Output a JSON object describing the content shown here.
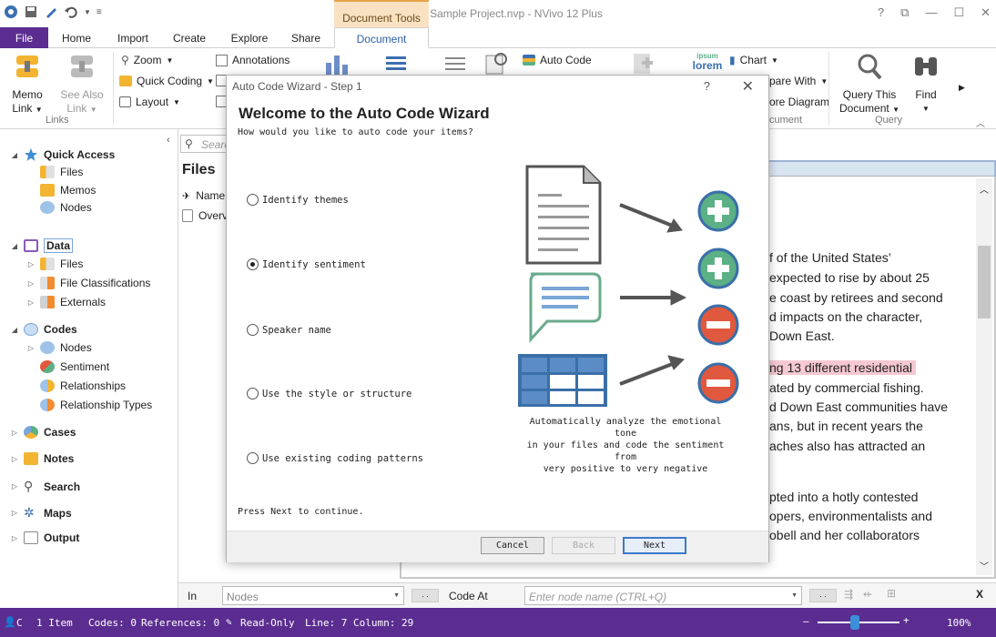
{
  "window": {
    "title": "Sample Project.nvp - NVivo 12 Plus",
    "context_tab_group": "Document Tools",
    "controls": [
      "?",
      "⧉",
      "—",
      "☐",
      "✕"
    ]
  },
  "tabs": [
    "File",
    "Home",
    "Import",
    "Create",
    "Explore",
    "Share",
    "Document"
  ],
  "ribbon": {
    "memo_link": "Memo\nLink",
    "memo_link_l1": "Memo",
    "memo_link_l2": "Link",
    "see_also_l1": "See Also",
    "see_also_l2": "Link",
    "links_group": "Links",
    "zoom": "Zoom",
    "quick_coding": "Quick Coding",
    "layout": "Layout",
    "annotations": "Annotations",
    "auto_code": "Auto Code",
    "chart": "Chart",
    "compare_with": "pare With",
    "explore_diagram": "ore Diagram",
    "document_group": "cument",
    "query_this_l1": "Query This",
    "query_this_l2": "Document",
    "find": "Find",
    "query_group": "Query",
    "lorem_label": "lorem",
    "ipsum_label": "ipsum"
  },
  "nav": {
    "quick_access": "Quick Access",
    "qa_files": "Files",
    "qa_memos": "Memos",
    "qa_nodes": "Nodes",
    "data": "Data",
    "data_files": "Files",
    "file_classifications": "File Classifications",
    "externals": "Externals",
    "codes": "Codes",
    "codes_nodes": "Nodes",
    "sentiment": "Sentiment",
    "relationships": "Relationships",
    "relationship_types": "Relationship Types",
    "cases": "Cases",
    "notes": "Notes",
    "search": "Search",
    "maps": "Maps",
    "output": "Output"
  },
  "files_panel": {
    "search_placeholder": "Search",
    "title": "Files",
    "col_name": "Name",
    "row1": "Overv"
  },
  "document_lines": [
    "f of the United States’",
    "expected to rise by about 25",
    "e coast by retirees and second",
    "d impacts on the character,",
    "Down East.",
    "ng 13 different residential",
    "ated by commercial fishing.",
    "d Down East communities have",
    "ans, but in recent years the",
    "aches also has attracted an",
    "pted into a hotly contested",
    "opers, environmentalists and",
    "obell and her collaborators"
  ],
  "highlight_color": "#f6c9d2",
  "code_bar": {
    "in_label": "In",
    "in_value": "Nodes",
    "code_at_label": "Code At",
    "node_placeholder": "Enter node name (CTRL+Q)",
    "close": "X"
  },
  "status": {
    "user": "C",
    "items": "1 Item",
    "codes": "Codes: 0",
    "references": "References: 0",
    "read_only": "Read-Only",
    "position": "Line: 7 Column: 29",
    "zoom": "100%",
    "zoom_level": 0.45
  },
  "dialog": {
    "title": "Auto Code Wizard - Step 1",
    "help": "?",
    "heading": "Welcome to the Auto Code Wizard",
    "prompt": "How would you like to auto code your items?",
    "options": [
      {
        "label": "Identify themes",
        "selected": false
      },
      {
        "label": "Identify sentiment",
        "selected": true
      },
      {
        "label": "Speaker name",
        "selected": false
      },
      {
        "label": "Use the style or structure",
        "selected": false
      },
      {
        "label": "Use existing coding patterns",
        "selected": false
      }
    ],
    "description_l1": "Automatically analyze the emotional tone",
    "description_l2": "in your files and code the sentiment from",
    "description_l3": "very positive to very negative",
    "footer_text": "Press Next to continue.",
    "cancel": "Cancel",
    "back": "Back",
    "next": "Next",
    "positive_color": "#5bb085",
    "negative_color": "#e0583e",
    "ring_color": "#3a6fa8"
  }
}
